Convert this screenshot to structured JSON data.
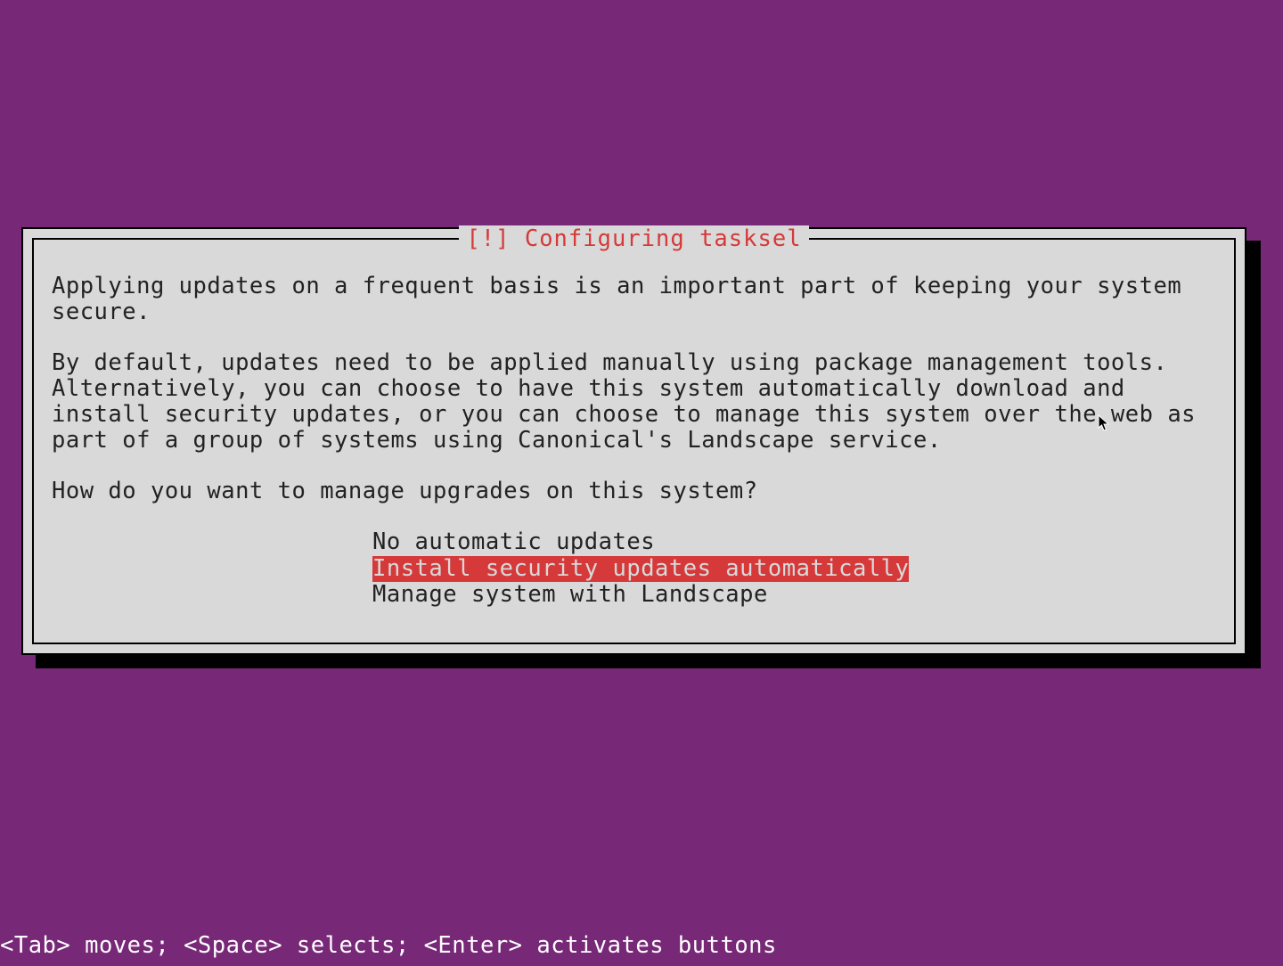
{
  "dialog": {
    "title": "[!] Configuring tasksel",
    "para1": "Applying updates on a frequent basis is an important part of keeping your system secure.",
    "para2": "By default, updates need to be applied manually using package management tools. Alternatively, you can choose to have this system automatically download and install security updates, or you can choose to manage this system over the web as part of a group of systems using Canonical's Landscape service.",
    "para3": "How do you want to manage upgrades on this system?",
    "options": [
      "No automatic updates",
      "Install security updates automatically",
      "Manage system with Landscape"
    ],
    "selected_index": 1
  },
  "footer": "<Tab> moves; <Space> selects; <Enter> activates buttons"
}
